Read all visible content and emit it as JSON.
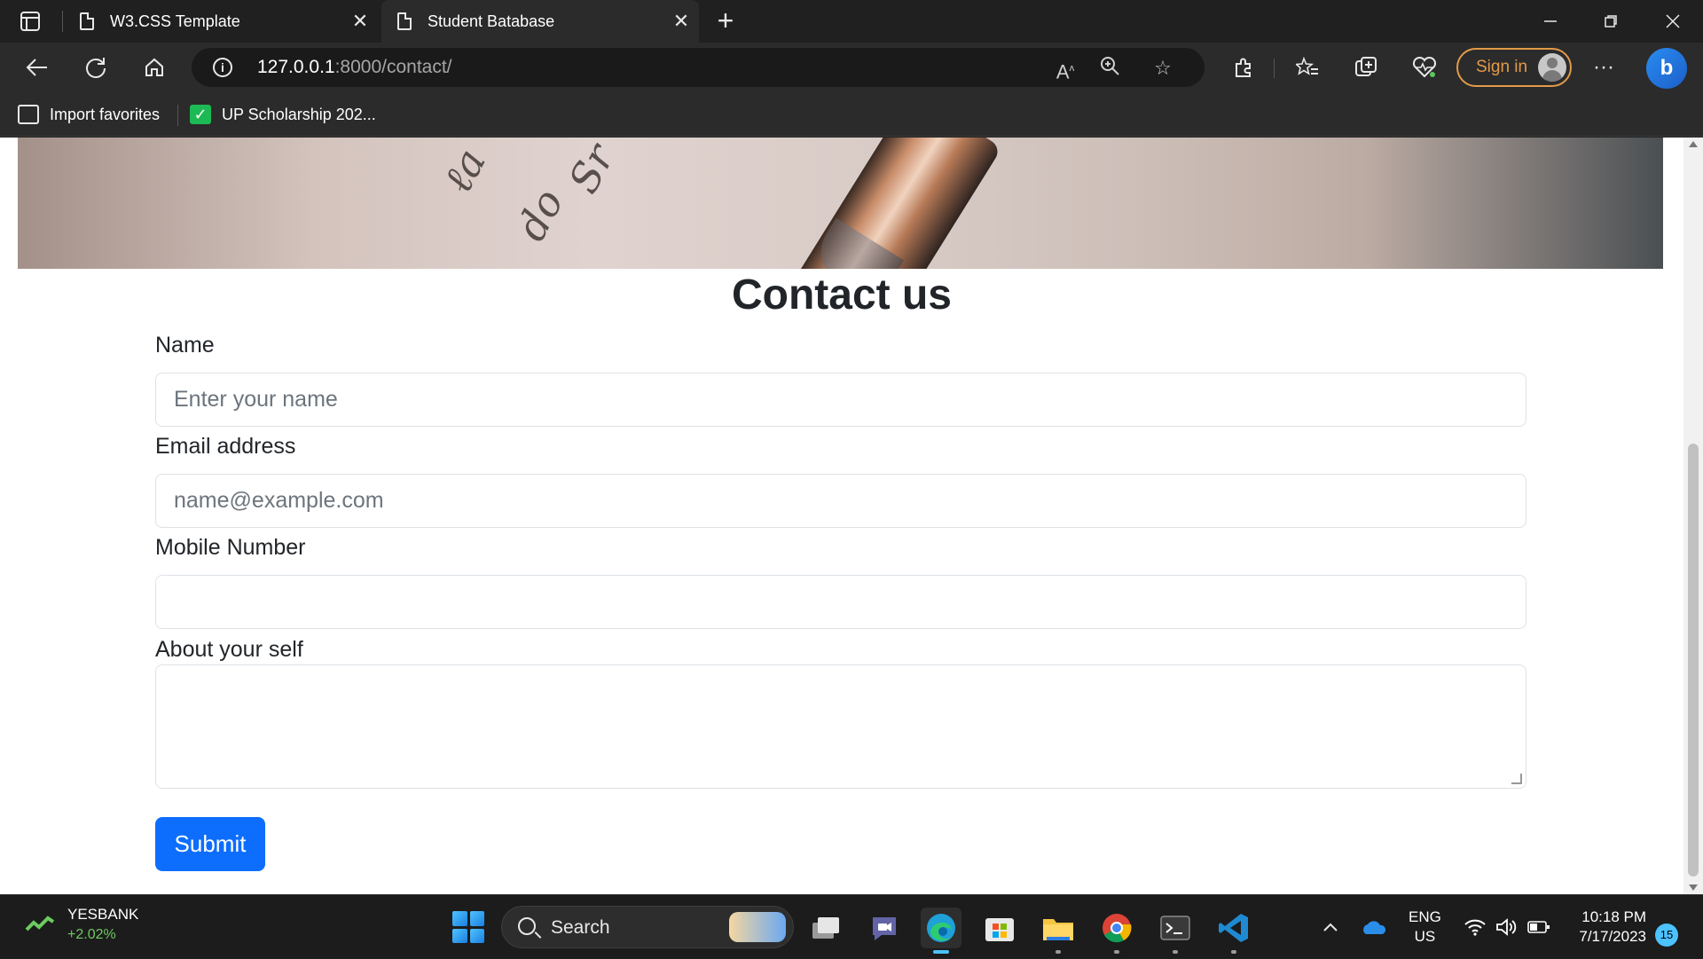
{
  "browser": {
    "tabs": [
      {
        "title": "W3.CSS Template",
        "active": false
      },
      {
        "title": "Student Batabase",
        "active": true
      }
    ],
    "address": {
      "host": "127.0.0.1",
      "path": ":8000/contact/"
    },
    "sign_in_label": "Sign in",
    "favorites": [
      {
        "label": "Import favorites"
      },
      {
        "label": "UP Scholarship 202..."
      }
    ]
  },
  "page": {
    "heading": "Contact us",
    "form": {
      "name_label": "Name",
      "name_placeholder": "Enter your name",
      "email_label": "Email address",
      "email_placeholder": "name@example.com",
      "mobile_label": "Mobile Number",
      "mobile_value": "",
      "about_label": "About your self",
      "about_value": "",
      "submit_label": "Submit"
    },
    "accent_color": "#0d6efd"
  },
  "taskbar": {
    "stock": {
      "name": "YESBANK",
      "change": "+2.02%"
    },
    "search_label": "Search",
    "apps": [
      "task-view",
      "teams",
      "edge",
      "store",
      "file-explorer",
      "chrome",
      "terminal",
      "vscode"
    ],
    "language": {
      "line1": "ENG",
      "line2": "US"
    },
    "clock": {
      "time": "10:18 PM",
      "date": "7/17/2023"
    },
    "notification_count": "15"
  }
}
